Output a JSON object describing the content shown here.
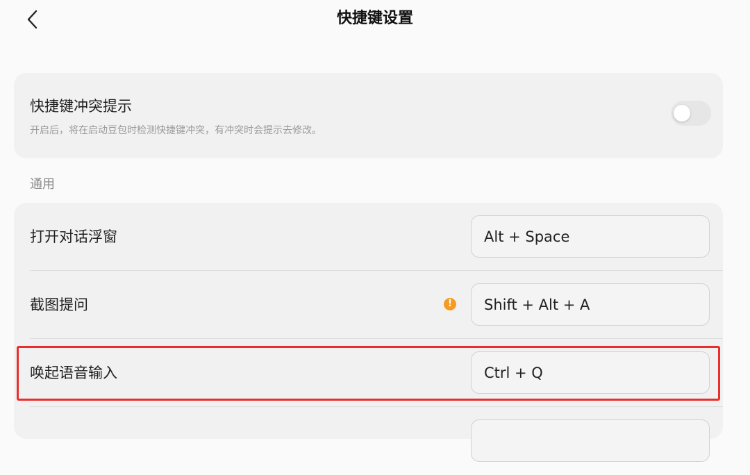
{
  "header": {
    "title": "快捷键设置",
    "back_icon": "chevron-left-icon"
  },
  "conflict": {
    "title": "快捷键冲突提示",
    "description": "开启后，将在启动豆包时检测快捷键冲突，有冲突时会提示去修改。",
    "enabled": false
  },
  "general": {
    "section_label": "通用",
    "items": [
      {
        "label": "打开对话浮窗",
        "shortcut": "Alt + Space",
        "warning": false
      },
      {
        "label": "截图提问",
        "shortcut": "Shift + Alt + A",
        "warning": true
      },
      {
        "label": "唤起语音输入",
        "shortcut": "Ctrl + Q",
        "warning": false,
        "highlighted": true
      },
      {
        "label": "",
        "shortcut": "",
        "warning": false
      }
    ]
  },
  "colors": {
    "warning": "#f59a23",
    "highlight": "#ea2d2d",
    "card_bg": "#f1f1f1"
  }
}
